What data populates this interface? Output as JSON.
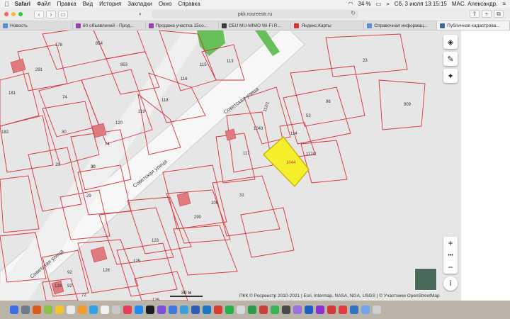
{
  "menubar": {
    "apple": "",
    "items": [
      "Safari",
      "Файл",
      "Правка",
      "Вид",
      "История",
      "Закладки",
      "Окно",
      "Справка"
    ],
    "battery": "34 %",
    "datetime": "Сб, 3 июля  13:15:15",
    "user": "MAC. Александр."
  },
  "toolbar": {
    "back": "‹",
    "forward": "›",
    "url": "pkk.rosreestr.ru",
    "shield_icon": "shield-icon",
    "reload_icon": "reload-icon"
  },
  "tabs": [
    {
      "label": "Новость",
      "color": "#5b8fd6"
    },
    {
      "label": "60 объявлений - Прод...",
      "color": "#9b3fb3"
    },
    {
      "label": "Продажа участка 15со...",
      "color": "#9b3fb3"
    },
    {
      "label": "CБU MU-MIMO Wi-Fi R...",
      "color": "#3c3c3c"
    },
    {
      "label": "Яндекс.Карты",
      "color": "#e63030"
    },
    {
      "label": "Справочная информац...",
      "color": "#5b8fd6"
    },
    {
      "label": "Публичная кадастрова...",
      "color": "#3a6aa8"
    }
  ],
  "map": {
    "street_label_1": "Советская улица",
    "street_label_2": "Советская улица",
    "street_label_3": "Советская улица",
    "highlight_parcel": "1044",
    "parcels": [
      "178",
      "854",
      "291",
      "181",
      "853",
      "115",
      "113",
      "116",
      "74",
      "118",
      "23",
      "119",
      "120",
      "96",
      "112/1",
      "53",
      "909",
      "183",
      "30",
      "74",
      "1043",
      "114",
      "30",
      "117",
      "112/2",
      "29",
      "30",
      "29",
      "31",
      "100",
      "290",
      "123",
      "92",
      "126",
      "125",
      "92",
      "128",
      "72",
      "125"
    ],
    "scale_label": "30 м",
    "attribution": "ПКК © Росреестр 2010-2021 | Esri, Intermap, NASA, NGA, USGS | © Участники OpenStreetMap",
    "zoom_in": "+",
    "zoom_out": "−",
    "zoom_mid": "•••",
    "info": "i"
  },
  "colors": {
    "parcel_stroke": "#d9323a",
    "highlight_fill": "#f4ef2a",
    "green_area": "#67c05a",
    "road": "#f5f5f5"
  },
  "dock_colors": [
    "#3b6ee6",
    "#6c7a90",
    "#d95a1e",
    "#8fbf48",
    "#f2c230",
    "#e9e9e9",
    "#f29a2b",
    "#35a0e8",
    "#f0f0f0",
    "#c7c7c7",
    "#e43d5a",
    "#1f8bf5",
    "#1c1c1c",
    "#7d4ed8",
    "#3f78e0",
    "#3d9ed8",
    "#2a5fb5",
    "#1a78c2",
    "#d83d2e",
    "#2ab04a",
    "#d8d8d8",
    "#2d9c4a",
    "#c9403a",
    "#36b357",
    "#4a4a4a",
    "#9c6ee0",
    "#1f5fc4",
    "#8e2fcf",
    "#d23838",
    "#e33c3c",
    "#2f74c0",
    "#70a5ec",
    "#cfcfcf"
  ]
}
